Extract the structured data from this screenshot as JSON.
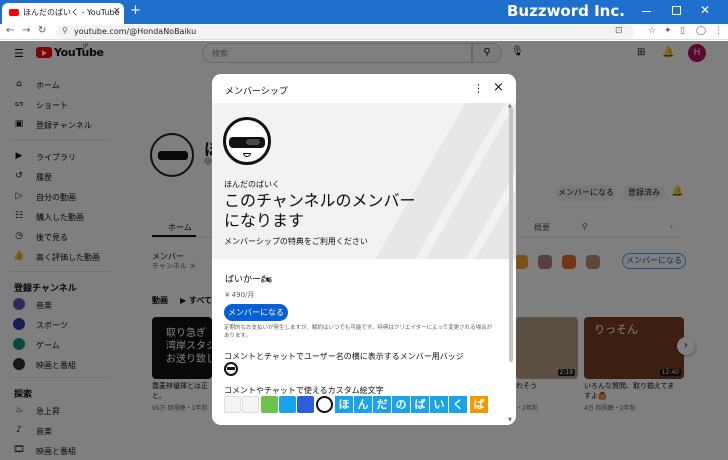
{
  "browser": {
    "tab_title": "ほんだのばいく - YouTube",
    "tab_close": "×",
    "new_tab": "+",
    "brand_watermark": "Buzzword Inc.",
    "url": "youtube.com/@HondaNoBaiku",
    "nav": {
      "back": "←",
      "forward": "→",
      "reload": "↻"
    }
  },
  "youtube": {
    "logo": "YouTube",
    "country": "JP",
    "search_placeholder": "検索",
    "avatar_letter": "H",
    "sidebar": {
      "main": [
        "ホーム",
        "ショート",
        "登録チャンネル"
      ],
      "you": [
        "ライブラリ",
        "履歴",
        "自分の動画",
        "購入した動画",
        "後で見る",
        "高く評価した動画"
      ],
      "subscriptions_header": "登録チャンネル",
      "subscriptions": [
        "音楽",
        "スポーツ",
        "ゲーム",
        "映画と番組"
      ],
      "explore_header": "探索",
      "explore": [
        "急上昇",
        "音楽",
        "映画と番組"
      ]
    },
    "channel": {
      "name_partial": "ほ",
      "handle_partial": "@",
      "join_button": "メンバーになる",
      "subscribed_button": "登録済み",
      "tab_home": "ホーム",
      "tab_overview": "概要",
      "members_label": "メンバー",
      "members_sub": "チャンネル メ",
      "members_pill": "メンバーになる",
      "videos_label": "動画",
      "play_all": "▶ すべて"
    },
    "videos": [
      {
        "thumb_text": [
          "取り急ぎ",
          "湾岸スタジ",
          "お送り致し"
        ],
        "title": [
          "喬麦林優揮とは正",
          "と。"
        ],
        "meta": "95万 回視聴・1年前"
      },
      {
        "title": [
          "れそう"
        ],
        "meta": "・2年前",
        "duration": "2:19"
      },
      {
        "title": [
          "いろんな質問、取り揃えてま",
          "すよ🙆"
        ],
        "meta": "4万 回視聴・2年前",
        "duration": "12:40",
        "thumb_text": "りっそん"
      }
    ]
  },
  "dialog": {
    "title": "メンバーシップ",
    "more": "⋮",
    "close": "×",
    "channel_name": "ほんだのばいく",
    "headline": "このチャンネルのメンバーになります",
    "subheadline": "メンバーシップの特典をご利用ください",
    "tier_name": "ばいかー🏍",
    "price": "¥ 490/月",
    "join_button": "メンバーになる",
    "fine_print": "定期的なお支払いが発生しますが、解約はいつでも可能です。特典はクリエイターによって変更される場合があります。",
    "perk_badge": "コメントとチャットでユーザー名の横に表示するメンバー用バッジ",
    "perk_emoji": "コメントやチャットで使えるカスタム絵文字",
    "emoji_letters": [
      "ほ",
      "ん",
      "だ",
      "の",
      "ば",
      "い",
      "く",
      "ば"
    ],
    "colors": {
      "join": "#065fd4",
      "emoji_cyan": "#1aa3e8",
      "emoji_orange": "#f39800"
    }
  }
}
